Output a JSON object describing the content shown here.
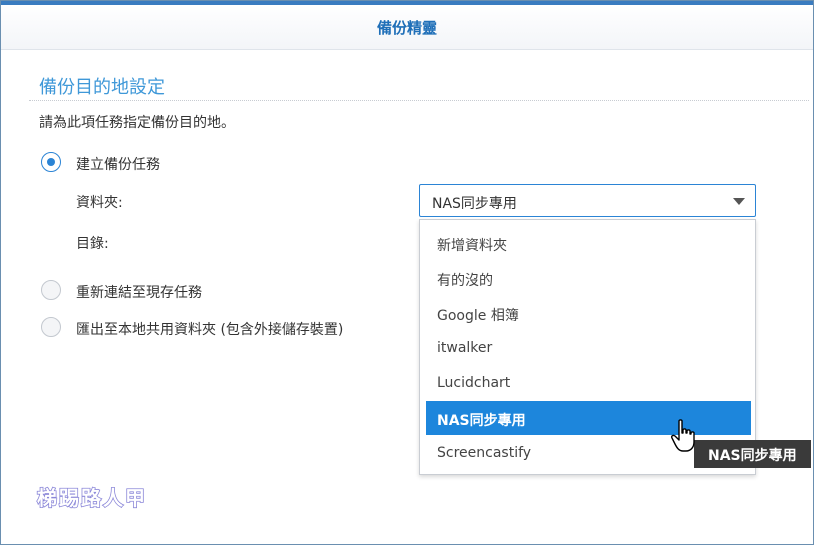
{
  "header": {
    "title": "備份精靈"
  },
  "section": {
    "title": "備份目的地設定",
    "instruction": "請為此項任務指定備份目的地。"
  },
  "options": [
    {
      "label": "建立備份任務",
      "checked": true
    },
    {
      "label": "重新連結至現存任務",
      "checked": false
    },
    {
      "label": "匯出至本地共用資料夾 (包含外接儲存裝置)",
      "checked": false
    }
  ],
  "fields": {
    "folder_label": "資料夾:",
    "directory_label": "目錄:"
  },
  "folder_select": {
    "value": "NAS同步專用",
    "options": [
      "新增資料夾",
      "有的沒的",
      "Google 相簿",
      "itwalker",
      "Lucidchart",
      "NAS同步專用",
      "Screencastify"
    ],
    "highlighted": "NAS同步專用"
  },
  "tooltip": {
    "text": "NAS同步專用"
  },
  "watermark": {
    "text": "梯踢路人甲"
  },
  "colors": {
    "accent": "#2b84d5",
    "header_text": "#1f6fb8",
    "section_title": "#3f98d8",
    "selected_bg": "#1d86dc",
    "tooltip_bg": "#3a3a3a"
  }
}
